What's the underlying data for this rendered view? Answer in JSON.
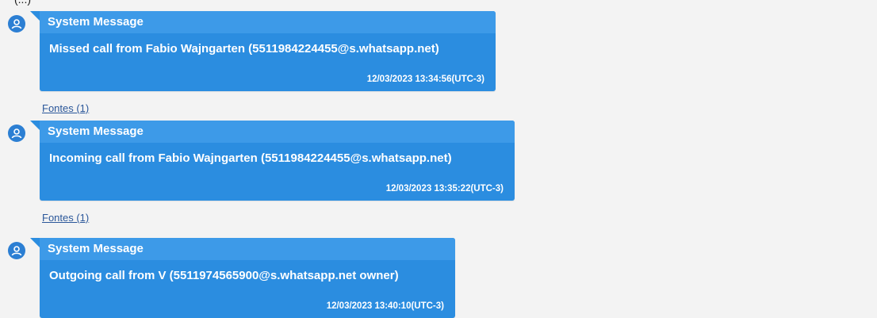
{
  "top_fragment": "(...)",
  "messages": [
    {
      "title": "System Message",
      "text": "Missed call from Fabio Wajngarten (5511984224455@s.whatsapp.net)",
      "timestamp": "12/03/2023 13:34:56(UTC-3)",
      "sources_link": "Fontes (1)"
    },
    {
      "title": "System Message",
      "text": "Incoming call from Fabio Wajngarten (5511984224455@s.whatsapp.net)",
      "timestamp": "12/03/2023 13:35:22(UTC-3)",
      "sources_link": "Fontes (1)"
    },
    {
      "title": "System Message",
      "text": "Outgoing call from V (5511974565900@s.whatsapp.net owner)",
      "timestamp": "12/03/2023 13:40:10(UTC-3)"
    }
  ],
  "icons": {
    "avatar": "user-avatar-icon"
  },
  "colors": {
    "bubble": "#2b8de0",
    "bubble_header": "#3d9ae8",
    "link": "#2b579a",
    "background": "#f3f3f3"
  }
}
